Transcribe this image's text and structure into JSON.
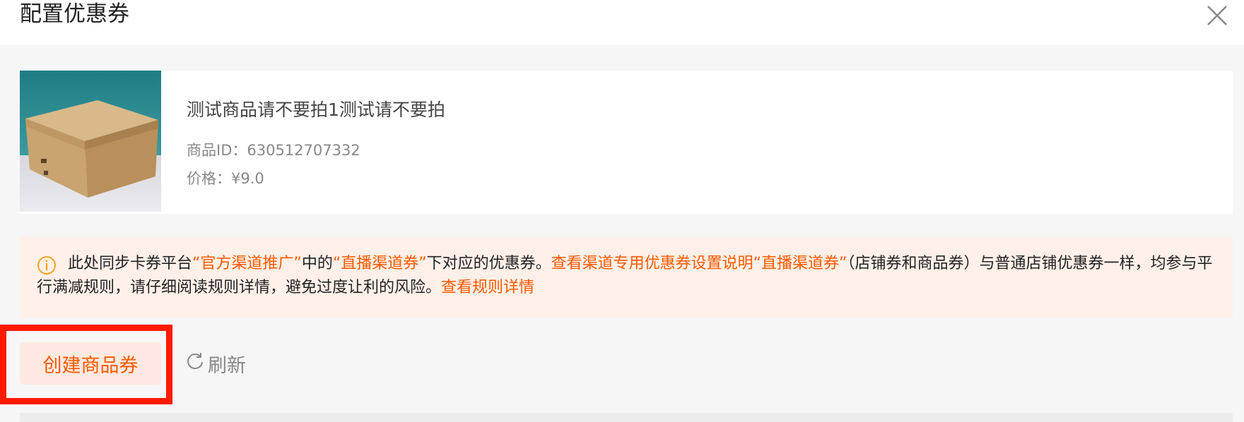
{
  "dialog": {
    "title": "配置优惠券",
    "close_icon": "close-icon"
  },
  "product": {
    "name": "测试商品请不要拍1测试请不要拍",
    "id_label": "商品ID：630512707332",
    "price_label": "价格：¥9.0",
    "image": "cardboard-box-photo"
  },
  "notice": {
    "icon": "info-circle-icon",
    "seg1": "此处同步卡券平台",
    "seg2": "“官方渠道推广”",
    "seg3": "中的",
    "seg4": "“直播渠道券”",
    "seg5": "下对应的优惠券。",
    "link1": "查看渠道专用优惠券设置说明",
    "seg6": "“直播渠道券”",
    "seg7": "（店铺券和商品券）与普通店铺优惠券一样，均参与平行满减规则，请仔细阅读规则详情，避免过度让利的风险。",
    "link2": "查看规则详情"
  },
  "actions": {
    "create_label": "创建商品券",
    "refresh_label": "刷新",
    "refresh_icon": "refresh-icon"
  },
  "colors": {
    "accent": "#ff5a00",
    "notice_bg": "#fff0e9",
    "highlight": "#ff1a00"
  }
}
